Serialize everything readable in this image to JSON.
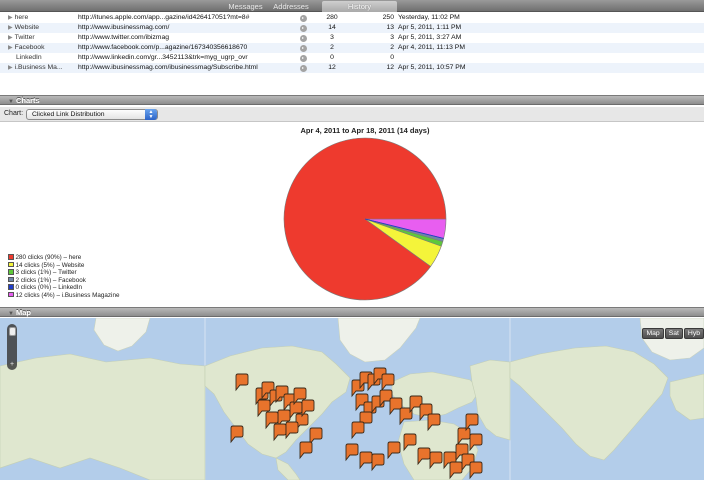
{
  "tabs": [
    {
      "label": "Messages",
      "active": false
    },
    {
      "label": "Addresses",
      "active": false
    },
    {
      "label": "History",
      "active": true
    }
  ],
  "table": {
    "rows": [
      {
        "name": "here",
        "disclosure": true,
        "url": "http://itunes.apple.com/app...gazine/id426417051?mt=8#",
        "count_a": "280",
        "count_b": "250",
        "date": "Yesterday, 11:02 PM"
      },
      {
        "name": "Website",
        "disclosure": true,
        "url": "http://www.ibusinessmag.com/",
        "count_a": "14",
        "count_b": "13",
        "date": "Apr 5, 2011, 1:11 PM"
      },
      {
        "name": "Twitter",
        "disclosure": true,
        "url": "http://www.twitter.com/ibizmag",
        "count_a": "3",
        "count_b": "3",
        "date": "Apr 5, 2011, 3:27 AM"
      },
      {
        "name": "Facebook",
        "disclosure": true,
        "url": "http://www.facebook.com/p...agazine/167340356618670",
        "count_a": "2",
        "count_b": "2",
        "date": "Apr 4, 2011, 11:13 PM"
      },
      {
        "name": "LinkedIn",
        "disclosure": false,
        "url": "http://www.linkedin.com/gr...3452113&trk=myg_ugrp_ovr",
        "count_a": "0",
        "count_b": "0",
        "date": ""
      },
      {
        "name": "i.Business Ma...",
        "disclosure": true,
        "url": "http://www.ibusinessmag.com/ibusinessmag/Subscribe.html",
        "count_a": "12",
        "count_b": "12",
        "date": "Apr 5, 2011, 10:57 PM"
      }
    ]
  },
  "sections": {
    "charts_label": "Charts",
    "map_label": "Map"
  },
  "chart_toolbar": {
    "label": "Chart:",
    "selected": "Clicked Link Distribution"
  },
  "chart_data": {
    "type": "pie",
    "title": "Apr 4, 2011 to Apr 18, 2011 (14 days)",
    "slices": [
      {
        "label": "280 clicks (90%) – here",
        "value": 280,
        "color": "#ee3a2e"
      },
      {
        "label": "14 clicks (5%) – Website",
        "value": 14,
        "color": "#f4f43a"
      },
      {
        "label": "3 clicks (1%) – Twitter",
        "value": 3,
        "color": "#5ec83a"
      },
      {
        "label": "2 clicks (1%) – Facebook",
        "value": 2,
        "color": "#6f86a8"
      },
      {
        "label": "0 clicks (0%) – LinkedIn",
        "value": 0,
        "color": "#1f3cc8"
      },
      {
        "label": "12 clicks (4%) – i.Business Magazine",
        "value": 12,
        "color": "#e85ef0"
      }
    ],
    "legend_position": "bottom-left"
  },
  "map": {
    "type_buttons": [
      "Map",
      "Sat",
      "Hyb"
    ],
    "zoom_plus": "+",
    "colors": {
      "water": "#b3cdea",
      "land": "#dfe7cf",
      "marker": "#e8732c"
    }
  },
  "icons": {
    "disclosure": "triangle-right-icon",
    "row_arrow": "go-arrow-icon",
    "select": "stepper-arrows-icon"
  }
}
